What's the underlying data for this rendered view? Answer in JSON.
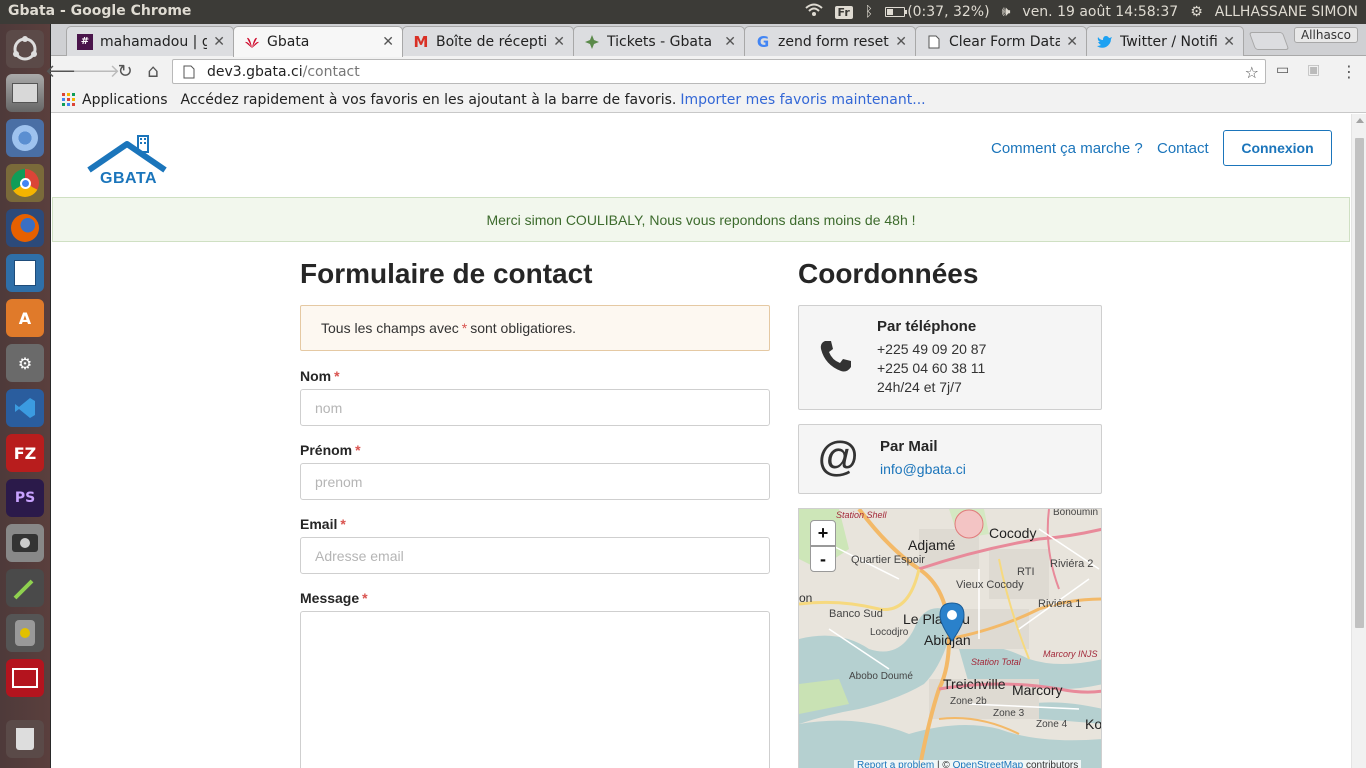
{
  "os_panel": {
    "window_title": "Gbata - Google Chrome",
    "keyboard_layout": "Fr",
    "battery_text": "(0:37, 32%)",
    "battery_level": 0.32,
    "datetime": "ven. 19 août 14:58:37",
    "user": "ALLHASSANE SIMON"
  },
  "browser": {
    "tabs": [
      {
        "label": "mahamadou | gl",
        "icon": "slack-icon",
        "active": false
      },
      {
        "label": "Gbata",
        "icon": "huawei-icon",
        "active": true
      },
      {
        "label": "Boîte de récepti",
        "icon": "gmail-icon",
        "active": false
      },
      {
        "label": "Tickets - Gbata",
        "icon": "tickets-icon",
        "active": false
      },
      {
        "label": "zend form reset",
        "icon": "google-icon",
        "active": false
      },
      {
        "label": "Clear Form Data",
        "icon": "page-icon",
        "active": false
      },
      {
        "label": "Twitter / Notific",
        "icon": "twitter-icon",
        "active": false
      }
    ],
    "profile_name": "Allhasco",
    "url_host": "dev3.gbata.ci",
    "url_path": "/contact",
    "bookmarks": {
      "apps_label": "Applications",
      "hint_text": "Accédez rapidement à vos favoris en les ajoutant à la barre de favoris.",
      "import_link": "Importer mes favoris maintenant..."
    }
  },
  "site": {
    "logo_text": "GBATA",
    "nav": {
      "how_it_works": "Comment ça marche ?",
      "contact": "Contact",
      "login": "Connexion"
    },
    "flash_message": "Merci simon COULIBALY, Nous vous repondons dans moins de 48h !",
    "form": {
      "title": "Formulaire de contact",
      "notice_before": "Tous les champs avec",
      "notice_star": "*",
      "notice_after": "sont obligatiores.",
      "required_mark": "*",
      "fields": {
        "nom": {
          "label": "Nom",
          "placeholder": "nom",
          "value": ""
        },
        "prenom": {
          "label": "Prénom",
          "placeholder": "prenom",
          "value": ""
        },
        "email": {
          "label": "Email",
          "placeholder": "Adresse email",
          "value": ""
        },
        "message": {
          "label": "Message",
          "value": ""
        }
      }
    },
    "coordinates": {
      "title": "Coordonnées",
      "phone": {
        "title": "Par téléphone",
        "lines": [
          "+225 49 09 20 87",
          "+225 04 60 38 11",
          "24h/24 et 7j/7"
        ]
      },
      "mail": {
        "title": "Par Mail",
        "address": "info@gbata.ci"
      }
    },
    "map": {
      "labels": {
        "station_shell": "Station Shell",
        "bonoumin": "Bonoumin",
        "adjame": "Adjamé",
        "cocody": "Cocody",
        "quartier_espoir": "Quartier Espoir",
        "riviera2": "Riviéra 2",
        "vieux_cocody": "Vieux Cocody",
        "rti": "RTI",
        "on": "on",
        "riviera1": "Riviéra 1",
        "banco_sud": "Banco Sud",
        "le_plateau": "Le Plateau",
        "locodjro": "Locodjro",
        "abidjan": "Abidjan",
        "marcory_inj": "Marcory INJS",
        "station_total": "Station Total",
        "abobo_doume": "Abobo Doumé",
        "treichville": "Treichville",
        "marcory": "Marcory",
        "zone2b": "Zone 2b",
        "zone3": "Zone 3",
        "zone4": "Zone 4",
        "ko": "Ko"
      },
      "zoom_in": "+",
      "zoom_out": "-",
      "attribution_report": "Report a problem",
      "attribution_sep": " | © ",
      "attribution_osm": "OpenStreetMap",
      "attribution_tail": " contributors"
    }
  }
}
